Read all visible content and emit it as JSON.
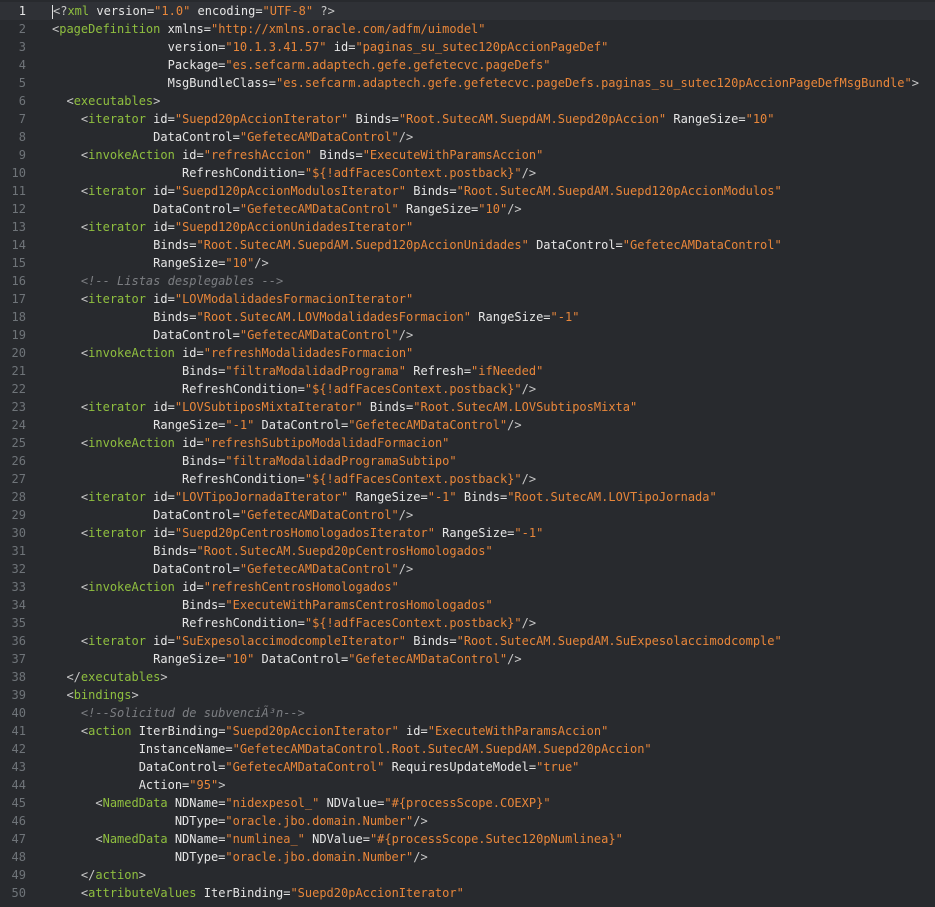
{
  "editor": {
    "theme": {
      "background": "#282a2e",
      "tag": "#8fbf3f",
      "string": "#e8863a",
      "comment": "#7c7e82",
      "attribute": "#e6e6e6",
      "line_number": "#6f7479"
    },
    "active_line": 1,
    "lines": [
      {
        "n": "1",
        "tokens": [
          [
            "br",
            "<?"
          ],
          [
            "tag",
            "xml"
          ],
          [
            "attr",
            " version="
          ],
          [
            "str",
            "\"1.0\""
          ],
          [
            "attr",
            " encoding="
          ],
          [
            "str",
            "\"UTF-8\""
          ],
          [
            "attr",
            " "
          ],
          [
            "br",
            "?>"
          ]
        ]
      },
      {
        "n": "2",
        "tokens": [
          [
            "br",
            "<"
          ],
          [
            "tag",
            "pageDefinition"
          ],
          [
            "attr",
            " xmlns="
          ],
          [
            "str",
            "\"http://xmlns.oracle.com/adfm/uimodel\""
          ]
        ]
      },
      {
        "n": "3",
        "tokens": [
          [
            "attr",
            "                version="
          ],
          [
            "str",
            "\"10.1.3.41.57\""
          ],
          [
            "attr",
            " id="
          ],
          [
            "str",
            "\"paginas_su_sutec120pAccionPageDef\""
          ]
        ]
      },
      {
        "n": "4",
        "tokens": [
          [
            "attr",
            "                Package="
          ],
          [
            "str",
            "\"es.sefcarm.adaptech.gefe.gefetecvc.pageDefs\""
          ]
        ]
      },
      {
        "n": "5",
        "tokens": [
          [
            "attr",
            "                MsgBundleClass="
          ],
          [
            "str",
            "\"es.sefcarm.adaptech.gefe.gefetecvc.pageDefs.paginas_su_sutec120pAccionPageDefMsgBundle\""
          ],
          [
            "br",
            ">"
          ]
        ]
      },
      {
        "n": "6",
        "tokens": [
          [
            "tx",
            "  "
          ],
          [
            "br",
            "<"
          ],
          [
            "tag",
            "executables"
          ],
          [
            "br",
            ">"
          ]
        ]
      },
      {
        "n": "7",
        "tokens": [
          [
            "tx",
            "    "
          ],
          [
            "br",
            "<"
          ],
          [
            "tag",
            "iterator"
          ],
          [
            "attr",
            " id="
          ],
          [
            "str",
            "\"Suepd20pAccionIterator\""
          ],
          [
            "attr",
            " Binds="
          ],
          [
            "str",
            "\"Root.SutecAM.SuepdAM.Suepd20pAccion\""
          ],
          [
            "attr",
            " RangeSize="
          ],
          [
            "str",
            "\"10\""
          ]
        ]
      },
      {
        "n": "8",
        "tokens": [
          [
            "attr",
            "              DataControl="
          ],
          [
            "str",
            "\"GefetecAMDataControl\""
          ],
          [
            "br",
            "/>"
          ]
        ]
      },
      {
        "n": "9",
        "tokens": [
          [
            "tx",
            "    "
          ],
          [
            "br",
            "<"
          ],
          [
            "tag",
            "invokeAction"
          ],
          [
            "attr",
            " id="
          ],
          [
            "str",
            "\"refreshAccion\""
          ],
          [
            "attr",
            " Binds="
          ],
          [
            "str",
            "\"ExecuteWithParamsAccion\""
          ]
        ]
      },
      {
        "n": "10",
        "tokens": [
          [
            "attr",
            "                  RefreshCondition="
          ],
          [
            "str",
            "\"${!adfFacesContext.postback}\""
          ],
          [
            "br",
            "/>"
          ]
        ]
      },
      {
        "n": "11",
        "tokens": [
          [
            "tx",
            "    "
          ],
          [
            "br",
            "<"
          ],
          [
            "tag",
            "iterator"
          ],
          [
            "attr",
            " id="
          ],
          [
            "str",
            "\"Suepd120pAccionModulosIterator\""
          ],
          [
            "attr",
            " Binds="
          ],
          [
            "str",
            "\"Root.SutecAM.SuepdAM.Suepd120pAccionModulos\""
          ]
        ]
      },
      {
        "n": "12",
        "tokens": [
          [
            "attr",
            "              DataControl="
          ],
          [
            "str",
            "\"GefetecAMDataControl\""
          ],
          [
            "attr",
            " RangeSize="
          ],
          [
            "str",
            "\"10\""
          ],
          [
            "br",
            "/>"
          ]
        ]
      },
      {
        "n": "13",
        "tokens": [
          [
            "tx",
            "    "
          ],
          [
            "br",
            "<"
          ],
          [
            "tag",
            "iterator"
          ],
          [
            "attr",
            " id="
          ],
          [
            "str",
            "\"Suepd120pAccionUnidadesIterator\""
          ]
        ]
      },
      {
        "n": "14",
        "tokens": [
          [
            "attr",
            "              Binds="
          ],
          [
            "str",
            "\"Root.SutecAM.SuepdAM.Suepd120pAccionUnidades\""
          ],
          [
            "attr",
            " DataControl="
          ],
          [
            "str",
            "\"GefetecAMDataControl\""
          ]
        ]
      },
      {
        "n": "15",
        "tokens": [
          [
            "attr",
            "              RangeSize="
          ],
          [
            "str",
            "\"10\""
          ],
          [
            "br",
            "/>"
          ]
        ]
      },
      {
        "n": "16",
        "tokens": [
          [
            "tx",
            "    "
          ],
          [
            "cm",
            "<!-- Listas desplegables -->"
          ]
        ]
      },
      {
        "n": "17",
        "tokens": [
          [
            "tx",
            "    "
          ],
          [
            "br",
            "<"
          ],
          [
            "tag",
            "iterator"
          ],
          [
            "attr",
            " id="
          ],
          [
            "str",
            "\"LOVModalidadesFormacionIterator\""
          ]
        ]
      },
      {
        "n": "18",
        "tokens": [
          [
            "attr",
            "              Binds="
          ],
          [
            "str",
            "\"Root.SutecAM.LOVModalidadesFormacion\""
          ],
          [
            "attr",
            " RangeSize="
          ],
          [
            "str",
            "\"-1\""
          ]
        ]
      },
      {
        "n": "19",
        "tokens": [
          [
            "attr",
            "              DataControl="
          ],
          [
            "str",
            "\"GefetecAMDataControl\""
          ],
          [
            "br",
            "/>"
          ]
        ]
      },
      {
        "n": "20",
        "tokens": [
          [
            "tx",
            "    "
          ],
          [
            "br",
            "<"
          ],
          [
            "tag",
            "invokeAction"
          ],
          [
            "attr",
            " id="
          ],
          [
            "str",
            "\"refreshModalidadesFormacion\""
          ]
        ]
      },
      {
        "n": "21",
        "tokens": [
          [
            "attr",
            "                  Binds="
          ],
          [
            "str",
            "\"filtraModalidadPrograma\""
          ],
          [
            "attr",
            " Refresh="
          ],
          [
            "str",
            "\"ifNeeded\""
          ]
        ]
      },
      {
        "n": "22",
        "tokens": [
          [
            "attr",
            "                  RefreshCondition="
          ],
          [
            "str",
            "\"${!adfFacesContext.postback}\""
          ],
          [
            "br",
            "/>"
          ]
        ]
      },
      {
        "n": "23",
        "tokens": [
          [
            "tx",
            "    "
          ],
          [
            "br",
            "<"
          ],
          [
            "tag",
            "iterator"
          ],
          [
            "attr",
            " id="
          ],
          [
            "str",
            "\"LOVSubtiposMixtaIterator\""
          ],
          [
            "attr",
            " Binds="
          ],
          [
            "str",
            "\"Root.SutecAM.LOVSubtiposMixta\""
          ]
        ]
      },
      {
        "n": "24",
        "tokens": [
          [
            "attr",
            "              RangeSize="
          ],
          [
            "str",
            "\"-1\""
          ],
          [
            "attr",
            " DataControl="
          ],
          [
            "str",
            "\"GefetecAMDataControl\""
          ],
          [
            "br",
            "/>"
          ]
        ]
      },
      {
        "n": "25",
        "tokens": [
          [
            "tx",
            "    "
          ],
          [
            "br",
            "<"
          ],
          [
            "tag",
            "invokeAction"
          ],
          [
            "attr",
            " id="
          ],
          [
            "str",
            "\"refreshSubtipoModalidadFormacion\""
          ]
        ]
      },
      {
        "n": "26",
        "tokens": [
          [
            "attr",
            "                  Binds="
          ],
          [
            "str",
            "\"filtraModalidadProgramaSubtipo\""
          ]
        ]
      },
      {
        "n": "27",
        "tokens": [
          [
            "attr",
            "                  RefreshCondition="
          ],
          [
            "str",
            "\"${!adfFacesContext.postback}\""
          ],
          [
            "br",
            "/>"
          ]
        ]
      },
      {
        "n": "28",
        "tokens": [
          [
            "tx",
            "    "
          ],
          [
            "br",
            "<"
          ],
          [
            "tag",
            "iterator"
          ],
          [
            "attr",
            " id="
          ],
          [
            "str",
            "\"LOVTipoJornadaIterator\""
          ],
          [
            "attr",
            " RangeSize="
          ],
          [
            "str",
            "\"-1\""
          ],
          [
            "attr",
            " Binds="
          ],
          [
            "str",
            "\"Root.SutecAM.LOVTipoJornada\""
          ]
        ]
      },
      {
        "n": "29",
        "tokens": [
          [
            "attr",
            "              DataControl="
          ],
          [
            "str",
            "\"GefetecAMDataControl\""
          ],
          [
            "br",
            "/>"
          ]
        ]
      },
      {
        "n": "30",
        "tokens": [
          [
            "tx",
            "    "
          ],
          [
            "br",
            "<"
          ],
          [
            "tag",
            "iterator"
          ],
          [
            "attr",
            " id="
          ],
          [
            "str",
            "\"Suepd20pCentrosHomologadosIterator\""
          ],
          [
            "attr",
            " RangeSize="
          ],
          [
            "str",
            "\"-1\""
          ]
        ]
      },
      {
        "n": "31",
        "tokens": [
          [
            "attr",
            "              Binds="
          ],
          [
            "str",
            "\"Root.SutecAM.Suepd20pCentrosHomologados\""
          ]
        ]
      },
      {
        "n": "32",
        "tokens": [
          [
            "attr",
            "              DataControl="
          ],
          [
            "str",
            "\"GefetecAMDataControl\""
          ],
          [
            "br",
            "/>"
          ]
        ]
      },
      {
        "n": "33",
        "tokens": [
          [
            "tx",
            "    "
          ],
          [
            "br",
            "<"
          ],
          [
            "tag",
            "invokeAction"
          ],
          [
            "attr",
            " id="
          ],
          [
            "str",
            "\"refreshCentrosHomologados\""
          ]
        ]
      },
      {
        "n": "34",
        "tokens": [
          [
            "attr",
            "                  Binds="
          ],
          [
            "str",
            "\"ExecuteWithParamsCentrosHomologados\""
          ]
        ]
      },
      {
        "n": "35",
        "tokens": [
          [
            "attr",
            "                  RefreshCondition="
          ],
          [
            "str",
            "\"${!adfFacesContext.postback}\""
          ],
          [
            "br",
            "/>"
          ]
        ]
      },
      {
        "n": "36",
        "tokens": [
          [
            "tx",
            "    "
          ],
          [
            "br",
            "<"
          ],
          [
            "tag",
            "iterator"
          ],
          [
            "attr",
            " id="
          ],
          [
            "str",
            "\"SuExpesolaccimodcompleIterator\""
          ],
          [
            "attr",
            " Binds="
          ],
          [
            "str",
            "\"Root.SutecAM.SuepdAM.SuExpesolaccimodcomple\""
          ]
        ]
      },
      {
        "n": "37",
        "tokens": [
          [
            "attr",
            "              RangeSize="
          ],
          [
            "str",
            "\"10\""
          ],
          [
            "attr",
            " DataControl="
          ],
          [
            "str",
            "\"GefetecAMDataControl\""
          ],
          [
            "br",
            "/>"
          ]
        ]
      },
      {
        "n": "38",
        "tokens": [
          [
            "tx",
            "  "
          ],
          [
            "br",
            "</"
          ],
          [
            "tag",
            "executables"
          ],
          [
            "br",
            ">"
          ]
        ]
      },
      {
        "n": "39",
        "tokens": [
          [
            "tx",
            "  "
          ],
          [
            "br",
            "<"
          ],
          [
            "tag",
            "bindings"
          ],
          [
            "br",
            ">"
          ]
        ]
      },
      {
        "n": "40",
        "tokens": [
          [
            "tx",
            "    "
          ],
          [
            "cm",
            "<!--Solicitud de subvenciÃ³n-->"
          ]
        ]
      },
      {
        "n": "41",
        "tokens": [
          [
            "tx",
            "    "
          ],
          [
            "br",
            "<"
          ],
          [
            "tag",
            "action"
          ],
          [
            "attr",
            " IterBinding="
          ],
          [
            "str",
            "\"Suepd20pAccionIterator\""
          ],
          [
            "attr",
            " id="
          ],
          [
            "str",
            "\"ExecuteWithParamsAccion\""
          ]
        ]
      },
      {
        "n": "42",
        "tokens": [
          [
            "attr",
            "            InstanceName="
          ],
          [
            "str",
            "\"GefetecAMDataControl.Root.SutecAM.SuepdAM.Suepd20pAccion\""
          ]
        ]
      },
      {
        "n": "43",
        "tokens": [
          [
            "attr",
            "            DataControl="
          ],
          [
            "str",
            "\"GefetecAMDataControl\""
          ],
          [
            "attr",
            " RequiresUpdateModel="
          ],
          [
            "str",
            "\"true\""
          ]
        ]
      },
      {
        "n": "44",
        "tokens": [
          [
            "attr",
            "            Action="
          ],
          [
            "str",
            "\"95\""
          ],
          [
            "br",
            ">"
          ]
        ]
      },
      {
        "n": "45",
        "tokens": [
          [
            "tx",
            "      "
          ],
          [
            "br",
            "<"
          ],
          [
            "tag",
            "NamedData"
          ],
          [
            "attr",
            " NDName="
          ],
          [
            "str",
            "\"nidexpesol_\""
          ],
          [
            "attr",
            " NDValue="
          ],
          [
            "str",
            "\"#{processScope.COEXP}\""
          ]
        ]
      },
      {
        "n": "46",
        "tokens": [
          [
            "attr",
            "                 NDType="
          ],
          [
            "str",
            "\"oracle.jbo.domain.Number\""
          ],
          [
            "br",
            "/>"
          ]
        ]
      },
      {
        "n": "47",
        "tokens": [
          [
            "tx",
            "      "
          ],
          [
            "br",
            "<"
          ],
          [
            "tag",
            "NamedData"
          ],
          [
            "attr",
            " NDName="
          ],
          [
            "str",
            "\"numlinea_\""
          ],
          [
            "attr",
            " NDValue="
          ],
          [
            "str",
            "\"#{processScope.Sutec120pNumlinea}\""
          ]
        ]
      },
      {
        "n": "48",
        "tokens": [
          [
            "attr",
            "                 NDType="
          ],
          [
            "str",
            "\"oracle.jbo.domain.Number\""
          ],
          [
            "br",
            "/>"
          ]
        ]
      },
      {
        "n": "49",
        "tokens": [
          [
            "tx",
            "    "
          ],
          [
            "br",
            "</"
          ],
          [
            "tag",
            "action"
          ],
          [
            "br",
            ">"
          ]
        ]
      },
      {
        "n": "50",
        "tokens": [
          [
            "tx",
            "    "
          ],
          [
            "br",
            "<"
          ],
          [
            "tag",
            "attributeValues"
          ],
          [
            "attr",
            " IterBinding="
          ],
          [
            "str",
            "\"Suepd20pAccionIterator\""
          ]
        ]
      }
    ]
  }
}
